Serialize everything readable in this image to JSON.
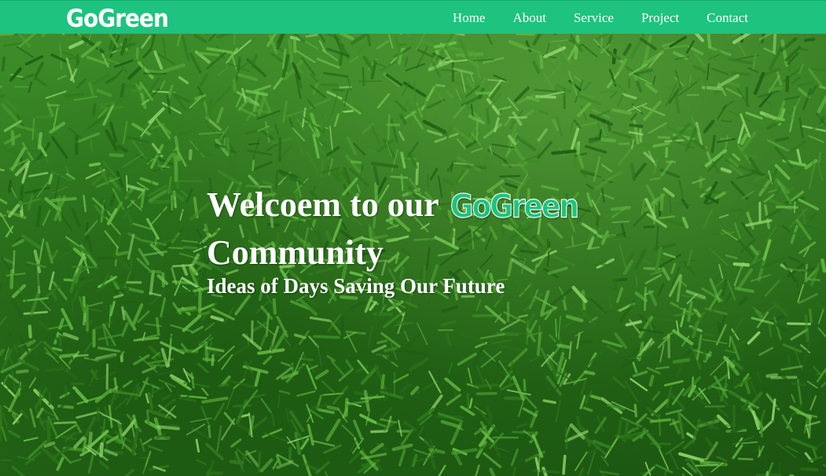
{
  "navbar": {
    "logo": "GoGreen",
    "links": [
      {
        "label": "Home"
      },
      {
        "label": "About"
      },
      {
        "label": "Service"
      },
      {
        "label": "Project"
      },
      {
        "label": "Contact"
      }
    ],
    "background_color": "#1dc37e"
  },
  "hero": {
    "headline_prefix": "Welcoem to our",
    "headline_brand": "GoGreen",
    "headline_suffix": "Community",
    "subheadline": "Ideas of Days Saving Our Future",
    "background": "grass-photo"
  }
}
